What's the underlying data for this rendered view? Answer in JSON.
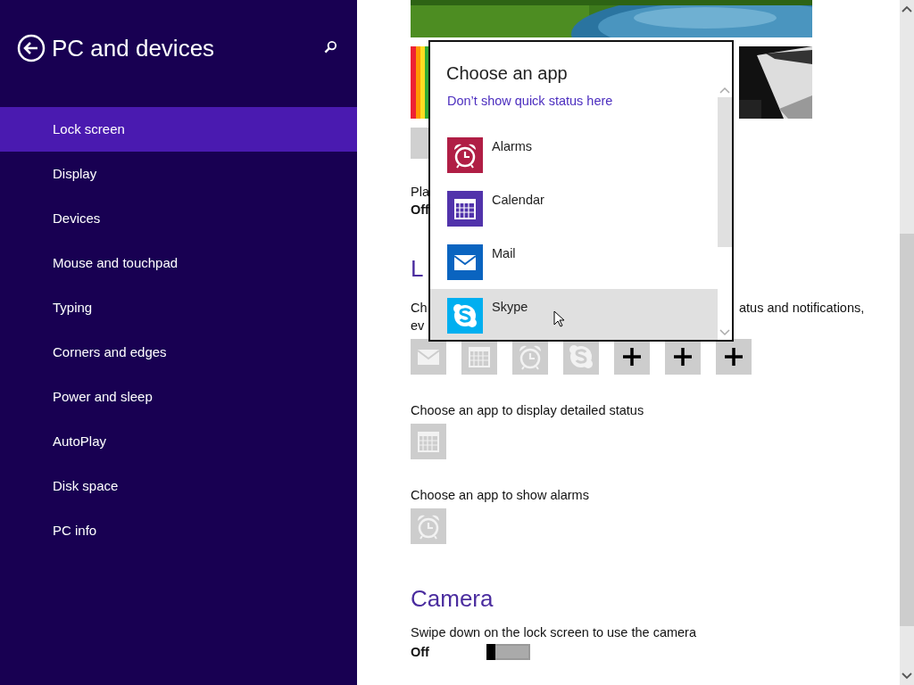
{
  "sidebar": {
    "title": "PC and devices",
    "items": [
      {
        "label": "Lock screen",
        "selected": true
      },
      {
        "label": "Display",
        "selected": false
      },
      {
        "label": "Devices",
        "selected": false
      },
      {
        "label": "Mouse and touchpad",
        "selected": false
      },
      {
        "label": "Typing",
        "selected": false
      },
      {
        "label": "Corners and edges",
        "selected": false
      },
      {
        "label": "Power and sleep",
        "selected": false
      },
      {
        "label": "AutoPlay",
        "selected": false
      },
      {
        "label": "Disk space",
        "selected": false
      },
      {
        "label": "PC info",
        "selected": false
      }
    ]
  },
  "content": {
    "slideshow_label": "Pla",
    "slideshow_value": "Off",
    "lock_heading": "L",
    "quick_status_text_start": "Ch",
    "quick_status_text_end": "atus and notifications,",
    "quick_status_text_line2": "ev",
    "quick_status_slots": [
      {
        "kind": "mail"
      },
      {
        "kind": "calendar"
      },
      {
        "kind": "alarm"
      },
      {
        "kind": "skype"
      },
      {
        "kind": "add"
      },
      {
        "kind": "add"
      },
      {
        "kind": "add"
      }
    ],
    "detailed_label": "Choose an app to display detailed status",
    "detailed_slot": {
      "kind": "calendar"
    },
    "alarms_label": "Choose an app to show alarms",
    "alarms_slot": {
      "kind": "alarm"
    },
    "camera_heading": "Camera",
    "camera_label": "Swipe down on the lock screen to use the camera",
    "camera_toggle": {
      "on": false,
      "state": "Off"
    }
  },
  "popup": {
    "title": "Choose an app",
    "link": "Don’t show quick status here",
    "apps": [
      {
        "name": "Alarms",
        "kind": "alarm",
        "color": "#b01e45",
        "highlighted": false
      },
      {
        "name": "Calendar",
        "kind": "calendar",
        "color": "#5133ab",
        "highlighted": false
      },
      {
        "name": "Mail",
        "kind": "mail",
        "color": "#0a64c0",
        "highlighted": false
      },
      {
        "name": "Skype",
        "kind": "skype",
        "color": "#00aff0",
        "highlighted": true
      }
    ]
  }
}
